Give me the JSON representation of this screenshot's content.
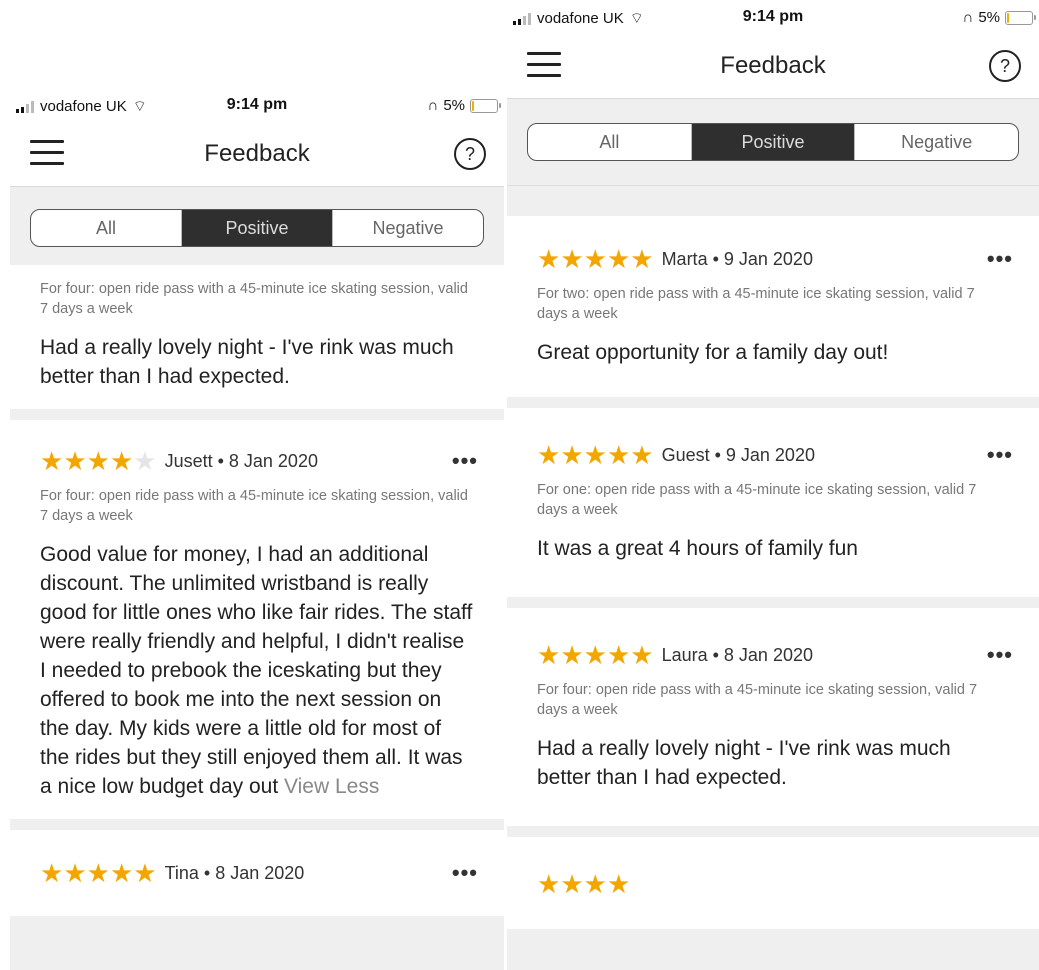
{
  "status": {
    "carrier": "vodafone UK",
    "time": "9:14 pm",
    "battery": "5%",
    "battery_level": 0.05
  },
  "header": {
    "title": "Feedback",
    "help_glyph": "?"
  },
  "filter": {
    "options": [
      "All",
      "Positive",
      "Negative"
    ],
    "selected": "Positive"
  },
  "accent_color": "#f4a600",
  "left_screen": {
    "partial_top_review": {
      "product": "For four: open ride pass with a 45-minute ice skating session, valid 7 days a week",
      "text": "Had a really lovely night - I've rink was much better than I had expected."
    },
    "reviews": [
      {
        "rating": 4,
        "meta": "Jusett • 8 Jan 2020",
        "product": "For four: open ride pass with a 45-minute ice skating session, valid 7 days a week",
        "text": "Good value for money, I had an additional discount.  The unlimited wristband is really good for little ones who like fair rides. The staff were really friendly and helpful, I didn't realise I needed to prebook the iceskating but they offered to book me into the next session on the day. My kids were a little old for most of the rides but they still enjoyed them all. It was a nice low budget day out",
        "view_less": "View Less"
      },
      {
        "rating": 5,
        "meta": "Tina • 8 Jan 2020"
      }
    ]
  },
  "right_screen": {
    "reviews": [
      {
        "rating": 5,
        "meta": "Marta • 9 Jan 2020",
        "product": "For two: open ride pass with a 45-minute ice skating session, valid 7 days a week",
        "text": "Great opportunity for a family day out!"
      },
      {
        "rating": 5,
        "meta": "Guest • 9 Jan 2020",
        "product": "For one: open ride pass with a 45-minute ice skating session, valid 7 days a week",
        "text": "It was a great 4 hours of family fun"
      },
      {
        "rating": 5,
        "meta": "Laura • 8 Jan 2020",
        "product": "For four: open ride pass with a 45-minute ice skating session, valid 7 days a week",
        "text": "Had a really lovely night - I've rink was much better than I had expected."
      }
    ]
  },
  "more_glyph": "•••"
}
